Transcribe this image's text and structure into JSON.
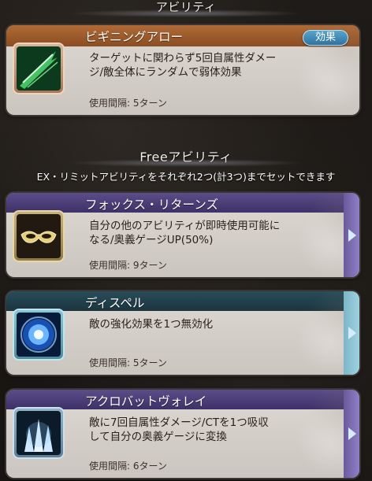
{
  "sections": {
    "top_header": "アビリティ",
    "free_header": "Freeアビリティ",
    "free_subtext": "EX・リミットアビリティをそれぞれ2つ(計3つ)までセットできます"
  },
  "cards": [
    {
      "name": "ビギニングアロー",
      "desc_lines": [
        "ターゲットに関わらず5回自属性ダメー",
        "ジ/敵全体にランダムで弱体効果"
      ],
      "cooldown": "使用間隔: 5ターン",
      "button_label": "効果",
      "icon": "green-arrow-icon"
    },
    {
      "name": "フォックス・リターンズ",
      "desc_lines": [
        "自分の他のアビリティが即時使用可能に",
        "なる/奥義ゲージUP(50%)"
      ],
      "cooldown": "使用間隔: 9ターン",
      "icon": "mask-icon"
    },
    {
      "name": "ディスペル",
      "desc_lines": [
        "敵の強化効果を1つ無効化"
      ],
      "cooldown": "使用間隔: 5ターン",
      "icon": "blue-orb-icon"
    },
    {
      "name": "アクロバットヴォレイ",
      "desc_lines": [
        "敵に7回自属性ダメージ/CTを1つ吸収",
        "して自分の奥義ゲージに変換"
      ],
      "cooldown": "使用間隔: 6ターン",
      "icon": "volley-icon"
    }
  ],
  "colors": {
    "accent_orange": "#a85e2d",
    "accent_purple": "#4a3c78",
    "accent_teal": "#203d48",
    "effect_button": "#3f8bb8"
  }
}
